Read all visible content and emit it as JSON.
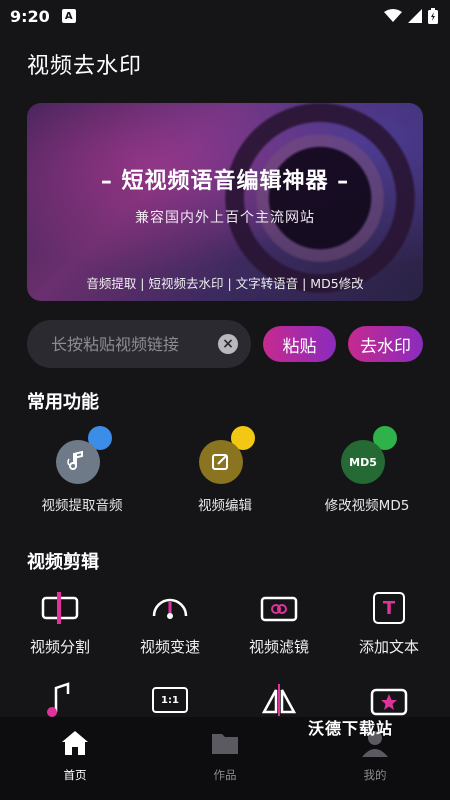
{
  "status": {
    "time": "9:20",
    "badge": "A"
  },
  "app": {
    "title": "视频去水印"
  },
  "banner": {
    "headline": "– 短视频语音编辑神器 –",
    "subtitle": "兼容国内外上百个主流网站",
    "features": "音频提取 | 短视频去水印 | 文字转语音 | MD5修改"
  },
  "search": {
    "value": "",
    "placeholder": "长按粘贴视频链接"
  },
  "buttons": {
    "paste": "粘贴",
    "remove": "去水印"
  },
  "sections": {
    "common": "常用功能",
    "edit": "视频剪辑"
  },
  "common_features": [
    {
      "label": "视频提取音频",
      "icon": "audio-extract-icon"
    },
    {
      "label": "视频编辑",
      "icon": "edit-icon"
    },
    {
      "label": "修改视频MD5",
      "icon": "md5-icon",
      "badge": "MD5"
    }
  ],
  "edit_tools": [
    {
      "label": "视频分割",
      "icon": "split-icon"
    },
    {
      "label": "视频变速",
      "icon": "speed-icon"
    },
    {
      "label": "视频滤镜",
      "icon": "filter-icon"
    },
    {
      "label": "添加文本",
      "icon": "text-icon",
      "glyph": "T"
    },
    {
      "icon": "music-icon"
    },
    {
      "icon": "ratio-icon",
      "glyph": "1:1"
    },
    {
      "icon": "mirror-icon"
    },
    {
      "icon": "sticker-icon"
    }
  ],
  "tabs": [
    {
      "label": "首页",
      "icon": "home-icon",
      "active": true
    },
    {
      "label": "作品",
      "icon": "folder-icon",
      "active": false
    },
    {
      "label": "我的",
      "icon": "user-icon",
      "active": false
    }
  ],
  "watermark": "沃德下载站",
  "colors": {
    "background": "#151518",
    "accent_start": "#c62a8f",
    "accent_end": "#8a2bbd",
    "icon_pink": "#e0339a"
  }
}
